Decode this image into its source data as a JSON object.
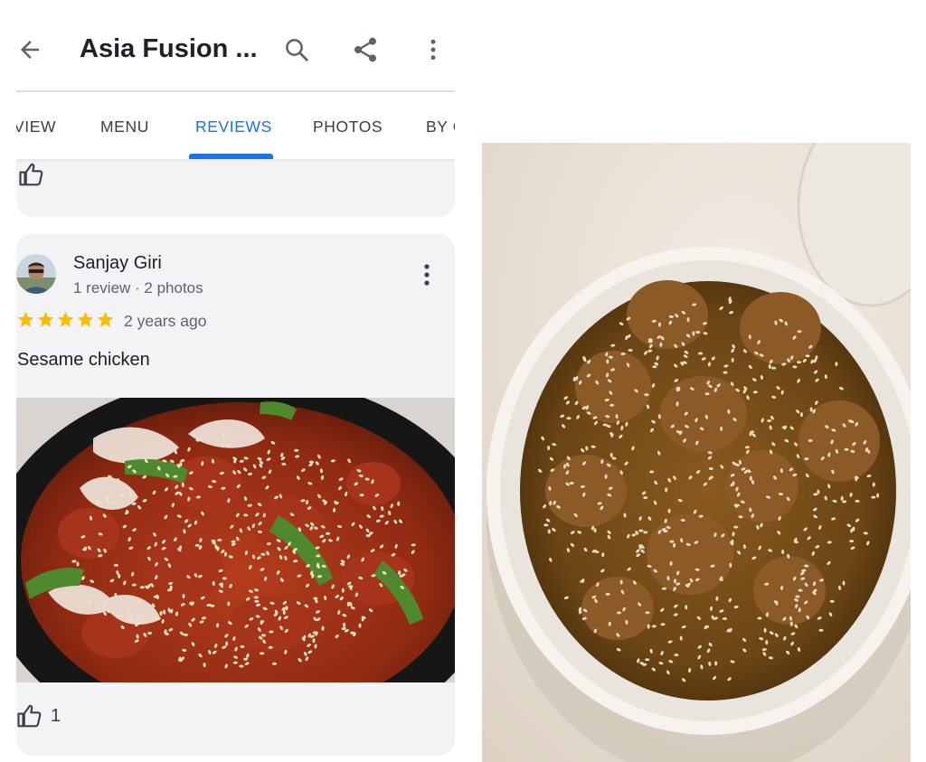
{
  "header": {
    "title": "Asia Fusion ...",
    "icons": {
      "back": "arrow-back-icon",
      "search": "search-icon",
      "share": "share-icon",
      "more": "more-vert-icon"
    }
  },
  "tabs": [
    {
      "label": "VIEW",
      "active": false
    },
    {
      "label": "MENU",
      "active": false
    },
    {
      "label": "REVIEWS",
      "active": true
    },
    {
      "label": "PHOTOS",
      "active": false
    },
    {
      "label": "BY C",
      "active": false
    }
  ],
  "review": {
    "reviewer_name": "Sanjay Giri",
    "reviewer_meta": "1 review · 2 photos",
    "rating": 5,
    "rating_max": 5,
    "time_ago": "2 years ago",
    "text": "Sesame chicken",
    "like_count": "1"
  },
  "colors": {
    "accent": "#1a73e8",
    "star": "#fbbc04",
    "card_bg": "#f2f3f5",
    "text_primary": "#202124",
    "text_secondary": "#5f6368"
  }
}
